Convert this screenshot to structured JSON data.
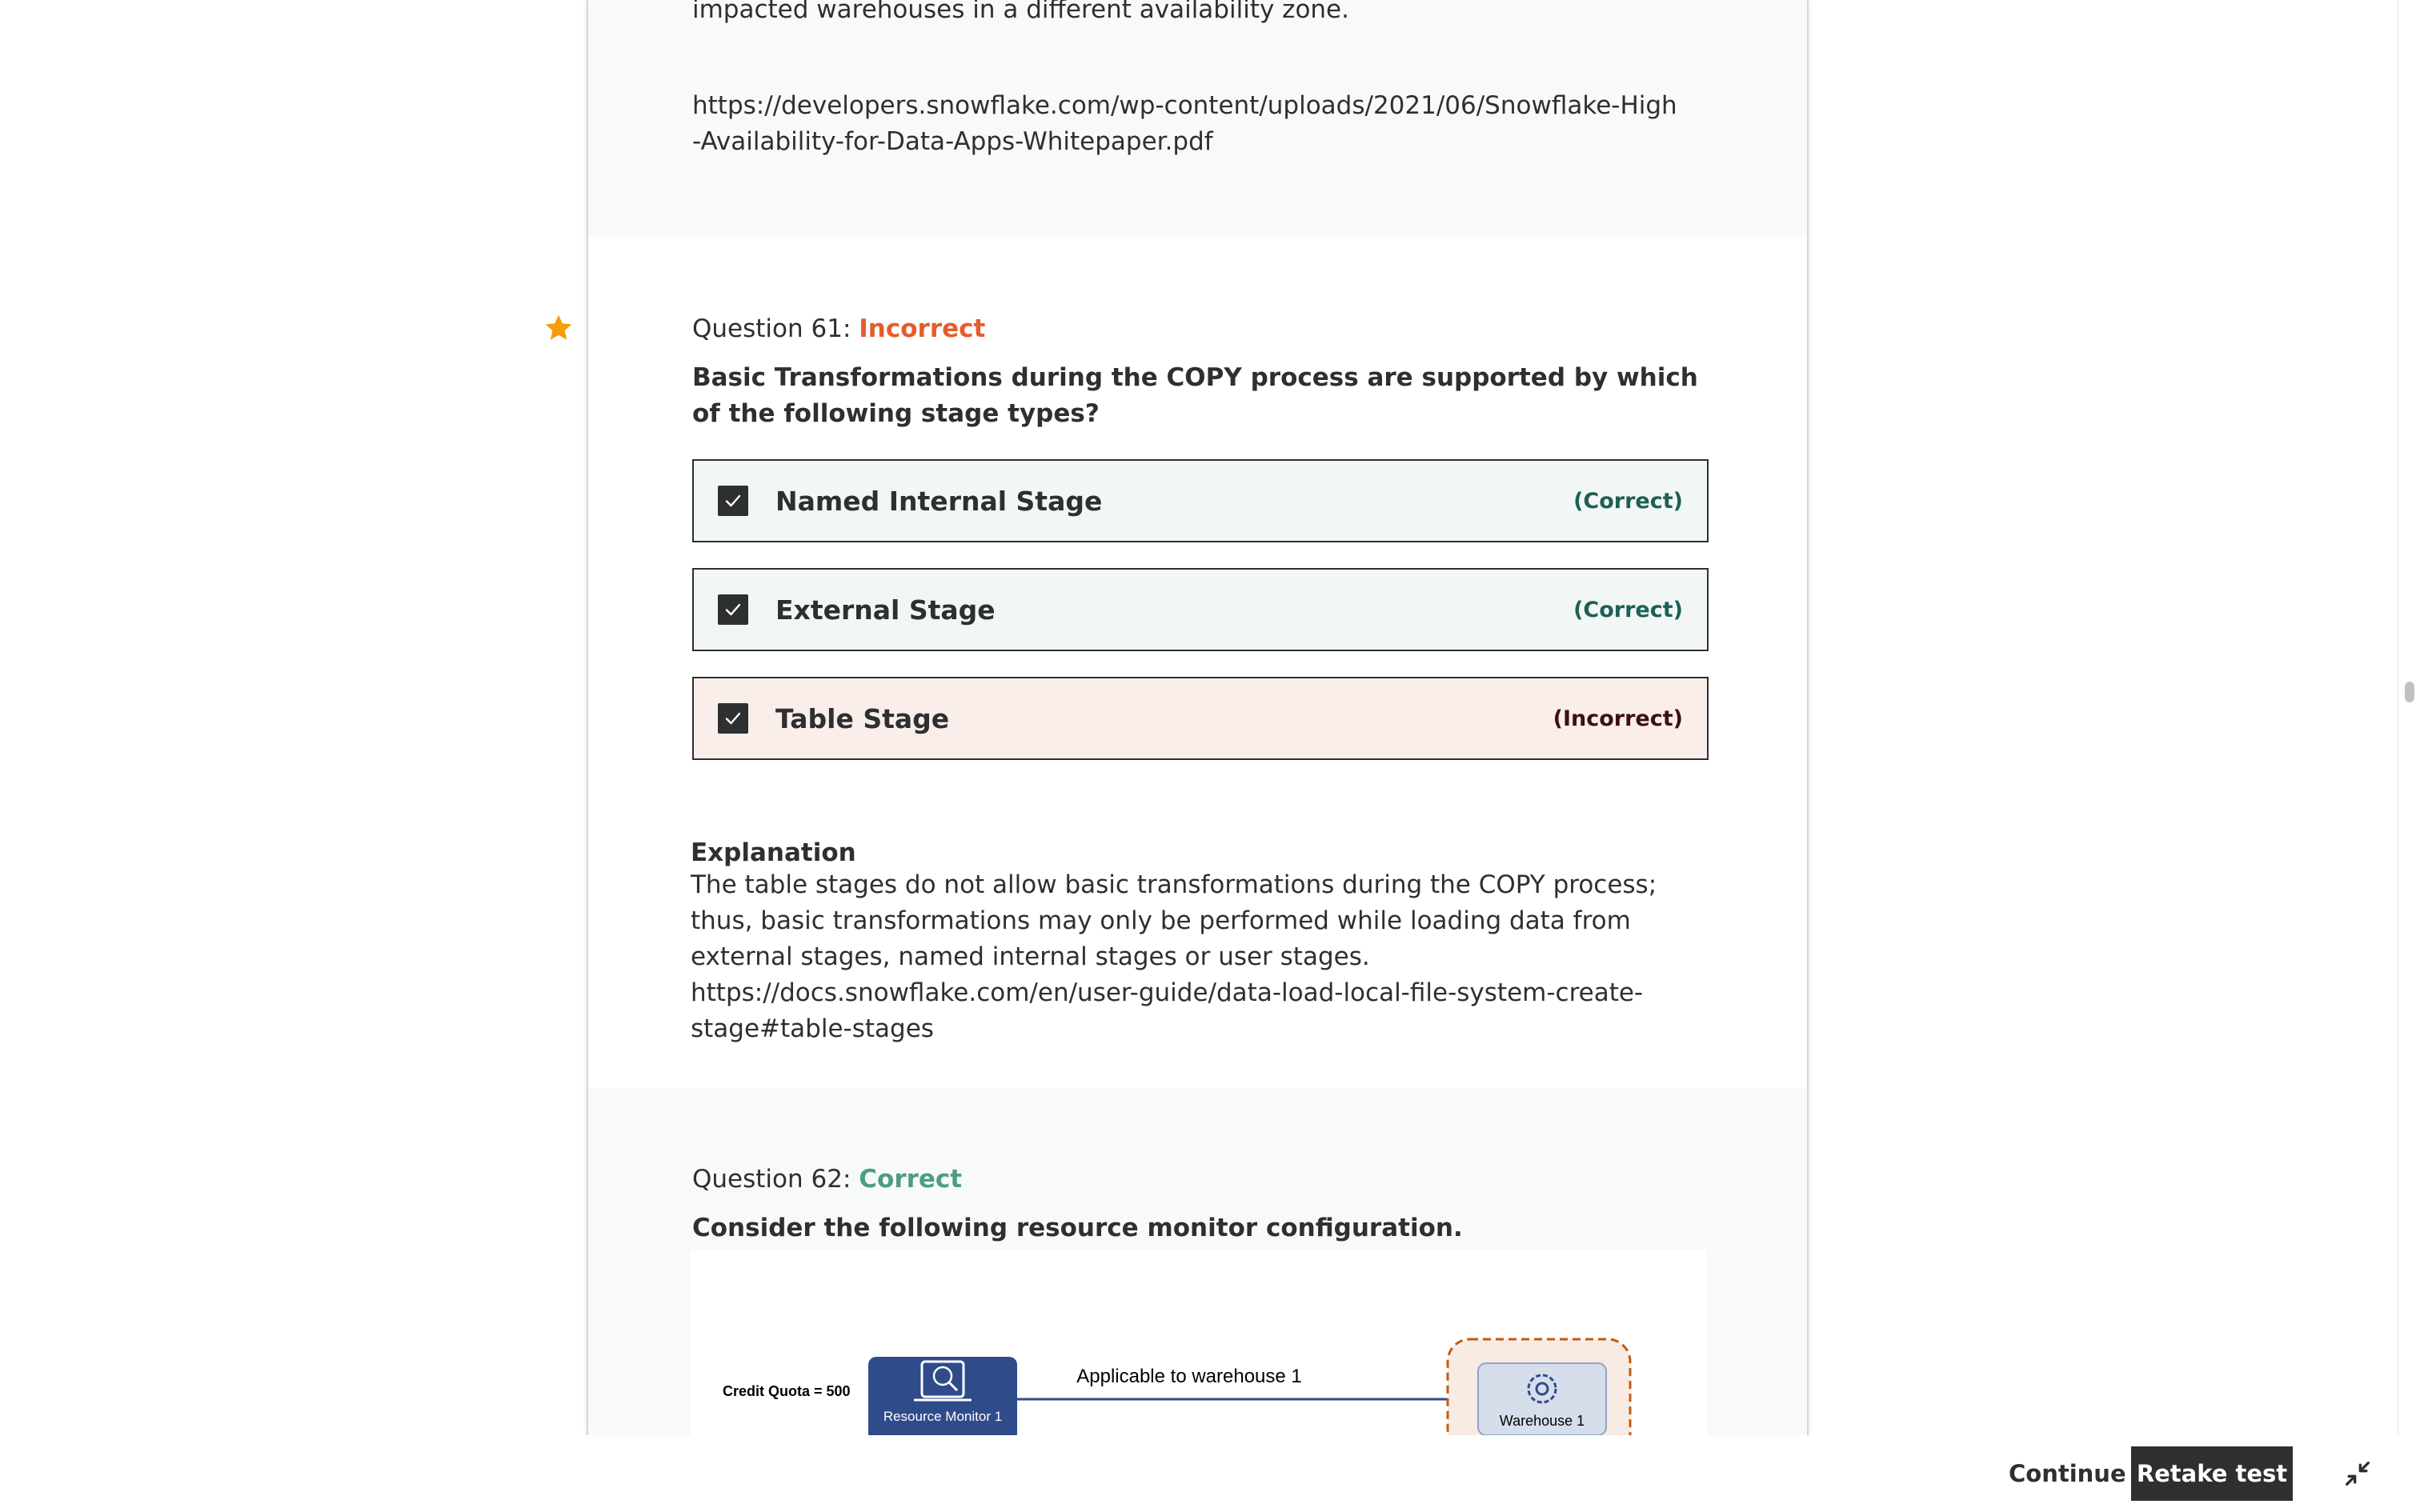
{
  "previous_question": {
    "tail_text": "impacted warehouses in a different availability zone.",
    "link": "https://developers.snowflake.com/wp-content/uploads/2021/06/Snowflake-High-Availability-for-Data-Apps-Whitepaper.pdf"
  },
  "q61": {
    "label": "Question 61: ",
    "status": "Incorrect",
    "status_color": "#e45d2b",
    "bookmark_icon": "star-icon",
    "bookmark_color": "#f69c08",
    "prompt": "Basic Transformations during the COPY process are supported by which of the following stage types?",
    "answers": [
      {
        "label": "Named Internal Stage",
        "result": "(Correct)",
        "checked": true
      },
      {
        "label": "External Stage",
        "result": "(Correct)",
        "checked": true
      },
      {
        "label": "Table Stage",
        "result": "(Incorrect)",
        "checked": true
      }
    ],
    "explanation_title": "Explanation",
    "explanation_text": "The table stages do not allow basic transformations during the COPY process; thus, basic transformations may only be performed while loading data from external stages, named internal stages or user stages. https://docs.snowflake.com/en/user-guide/data-load-local-file-system-create-stage#table-stages"
  },
  "q62": {
    "label": "Question 62: ",
    "status": "Correct",
    "status_color": "#4d9f7c",
    "prompt": "Consider the following resource monitor configuration.",
    "diagram": {
      "credit_quota": "Credit Quota = 500",
      "monitor_label": "Resource Monitor 1",
      "arrow_label": "Applicable to warehouse 1",
      "warehouse_label": "Warehouse 1"
    }
  },
  "footer": {
    "continue_label": "Continue",
    "retake_label": "Retake test",
    "collapse_icon": "collapse-icon"
  },
  "colors": {
    "correct_bg": "#f2f7f6",
    "incorrect_bg": "#faeeea",
    "primary_dark": "#2d2f31",
    "diagram_blue": "#2f4b8a"
  }
}
